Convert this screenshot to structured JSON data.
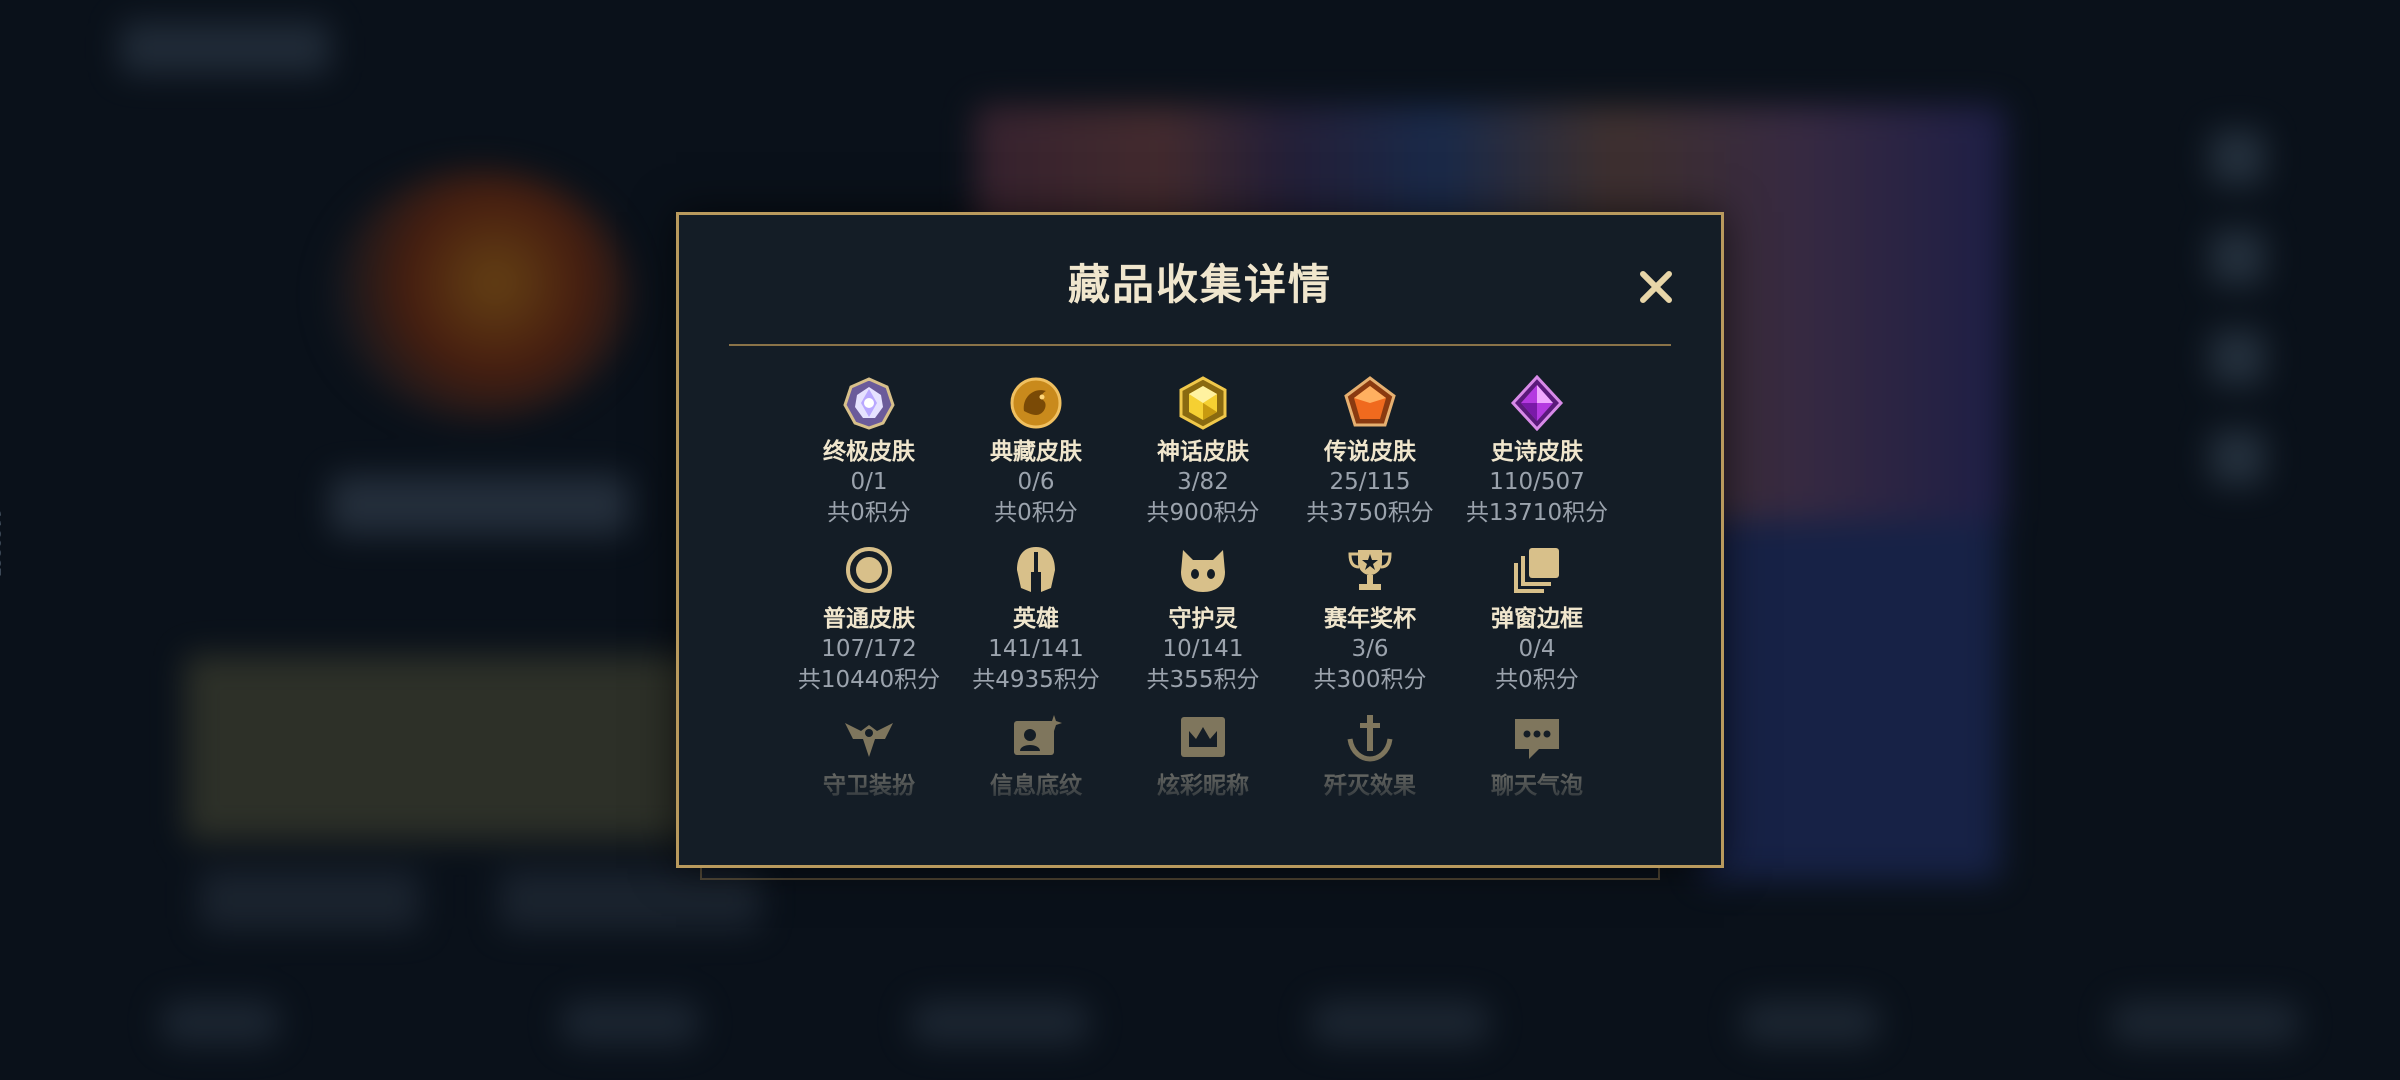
{
  "build_id": "1189867",
  "dialog": {
    "title": "藏品收集详情",
    "close_icon": "close-x-icon",
    "rows": [
      [
        {
          "name": "终极皮肤",
          "count": "0/1",
          "points": "共0积分",
          "icon": "ultimate-gem-icon"
        },
        {
          "name": "典藏皮肤",
          "count": "0/6",
          "points": "共0积分",
          "icon": "dragon-emblem-icon"
        },
        {
          "name": "神话皮肤",
          "count": "3/82",
          "points": "共900积分",
          "icon": "mythic-gem-icon"
        },
        {
          "name": "传说皮肤",
          "count": "25/115",
          "points": "共3750积分",
          "icon": "legendary-gem-icon"
        },
        {
          "name": "史诗皮肤",
          "count": "110/507",
          "points": "共13710积分",
          "icon": "epic-gem-icon"
        }
      ],
      [
        {
          "name": "普通皮肤",
          "count": "107/172",
          "points": "共10440积分",
          "icon": "ring-icon"
        },
        {
          "name": "英雄",
          "count": "141/141",
          "points": "共4935积分",
          "icon": "helmet-icon"
        },
        {
          "name": "守护灵",
          "count": "10/141",
          "points": "共355积分",
          "icon": "guardian-face-icon"
        },
        {
          "name": "赛年奖杯",
          "count": "3/6",
          "points": "共300积分",
          "icon": "trophy-icon"
        },
        {
          "name": "弹窗边框",
          "count": "0/4",
          "points": "共0积分",
          "icon": "stacked-frames-icon"
        }
      ],
      [
        {
          "name": "守卫装扮",
          "icon": "ward-icon"
        },
        {
          "name": "信息底纹",
          "icon": "profile-card-icon"
        },
        {
          "name": "炫彩昵称",
          "icon": "crown-tag-icon"
        },
        {
          "name": "歼灭效果",
          "icon": "anchor-icon"
        },
        {
          "name": "聊天气泡",
          "icon": "chat-bubble-icon"
        }
      ]
    ]
  },
  "colors": {
    "gold_border": "#b99a5d",
    "dialog_bg": "#141d26",
    "title_text": "#f0e6cd",
    "sub_text": "#9ba3ad",
    "icon_gold": "#d8c08a"
  }
}
